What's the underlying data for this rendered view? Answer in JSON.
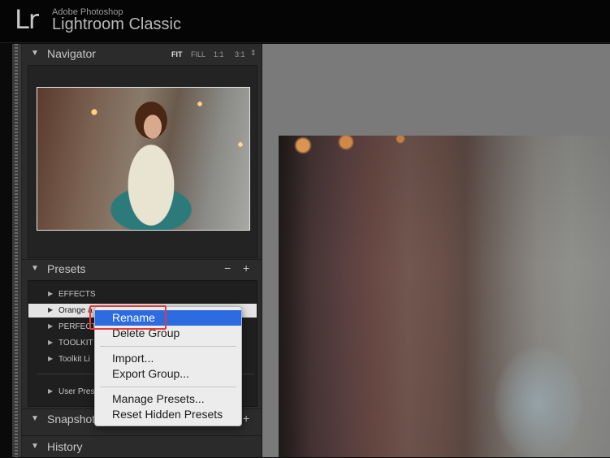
{
  "app": {
    "logo": "Lr",
    "vendor": "Adobe Photoshop",
    "name": "Lightroom Classic"
  },
  "navigator": {
    "title": "Navigator",
    "zoom_options": [
      "FIT",
      "FILL",
      "1:1",
      "3:1"
    ],
    "active_zoom": "FIT"
  },
  "presets": {
    "title": "Presets",
    "items": [
      {
        "label": "EFFECTS"
      },
      {
        "label": "Orange a"
      },
      {
        "label": "PERFECT"
      },
      {
        "label": "TOOLKIT"
      },
      {
        "label": "Toolkit Li"
      },
      {
        "label": "User Pres"
      }
    ],
    "selected_index": 1
  },
  "snapshots": {
    "title": "Snapshot"
  },
  "history": {
    "title": "History"
  },
  "context_menu": {
    "items": [
      {
        "label": "Rename",
        "highlighted": true
      },
      {
        "label": "Delete Group"
      },
      {
        "label": "Import..."
      },
      {
        "label": "Export Group..."
      },
      {
        "label": "Manage Presets..."
      },
      {
        "label": "Reset Hidden Presets"
      }
    ]
  },
  "colors": {
    "highlight": "#2c6be0",
    "annotation": "#e83a3a"
  }
}
